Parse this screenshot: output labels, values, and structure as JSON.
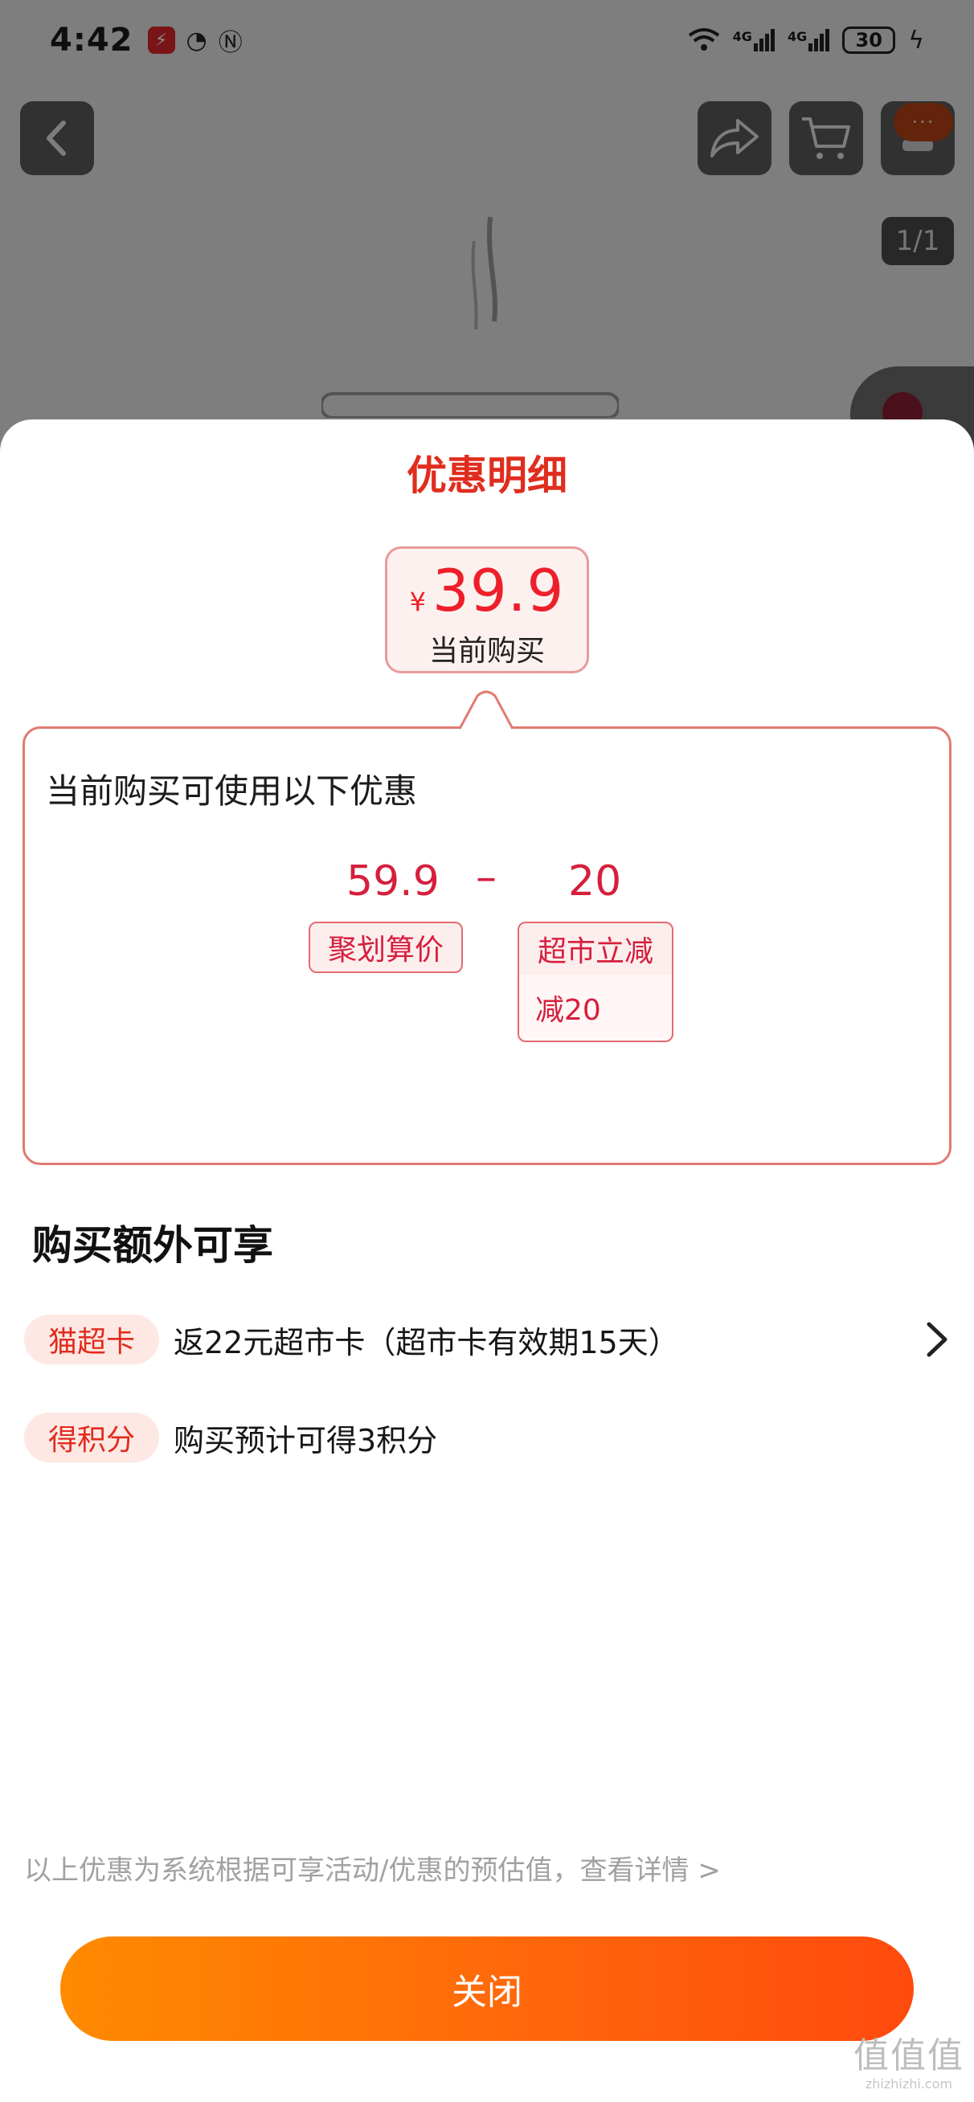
{
  "status_bar": {
    "time": "4:42",
    "battery": "30",
    "network_1": "4G",
    "network_2": "4G"
  },
  "background": {
    "page_counter": "1/1",
    "more_badge": "···",
    "icons": [
      "back-icon",
      "share-icon",
      "cart-icon",
      "more-icon"
    ]
  },
  "sheet": {
    "title": "优惠明细",
    "price": {
      "currency": "¥",
      "value": "39.9",
      "caption": "当前购买"
    },
    "discount": {
      "heading": "当前购买可使用以下优惠",
      "base_value": "59.9",
      "minus": "–",
      "reduction_value": "20",
      "base_tag": "聚划算价",
      "reduction_tag": "超市立减",
      "reduction_detail": "减20"
    },
    "extras": {
      "heading": "购买额外可享",
      "items": [
        {
          "badge": "猫超卡",
          "text": "返22元超市卡（超市卡有效期15天）",
          "has_arrow": true
        },
        {
          "badge": "得积分",
          "text": "购买预计可得3积分",
          "has_arrow": false
        }
      ]
    },
    "disclaimer": "以上优惠为系统根据可享活动/优惠的预估值，查看详情 >",
    "close_label": "关闭"
  },
  "watermark": {
    "glyphs": "值值值",
    "url": "zhizhizhi.com"
  },
  "colors": {
    "accent_red": "#e02d1e",
    "price_red": "#ee1f2a",
    "button_orange": "#ff6a0a"
  }
}
